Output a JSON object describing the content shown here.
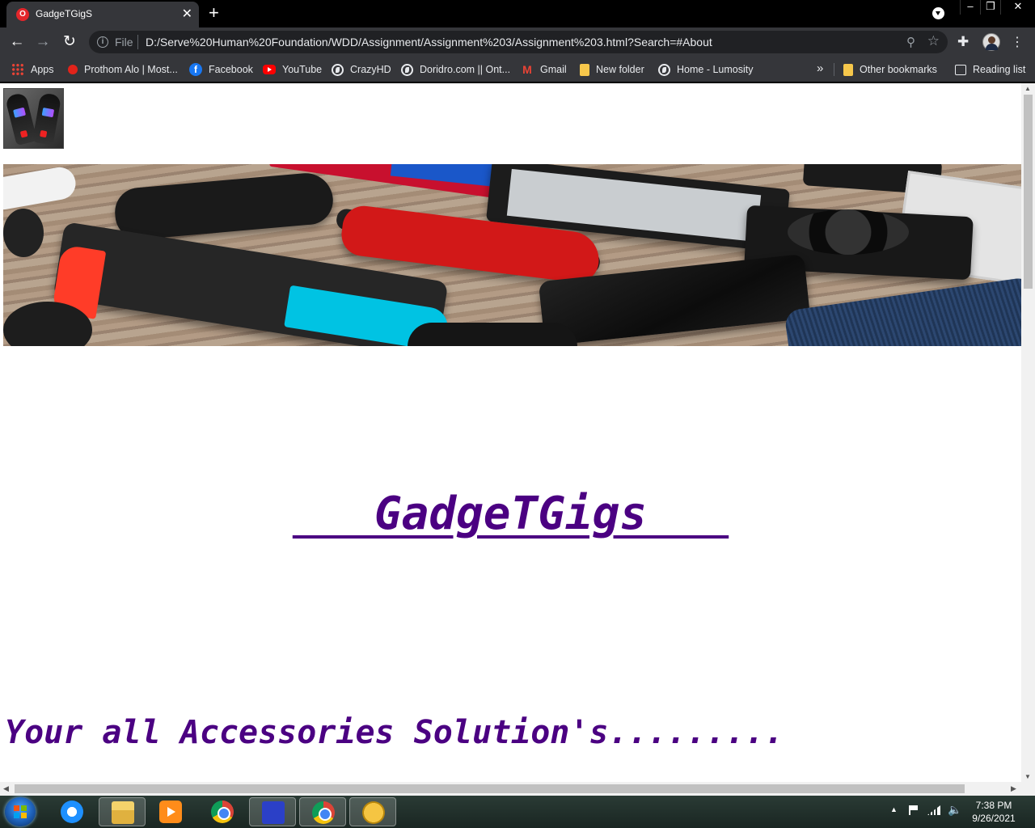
{
  "tab": {
    "title": "GadgeTGigS",
    "favicon": "opera-style-favicon"
  },
  "window": {
    "minimize_icon": "–",
    "restore_icon": "❐",
    "close_icon": "✕"
  },
  "toolbar": {
    "back_icon": "←",
    "forward_icon": "→",
    "reload_icon": "↻",
    "scheme_label": "File",
    "url": "D:/Serve%20Human%20Foundation/WDD/Assignment/Assignment%203/Assignment%203.html?Search=#About"
  },
  "bookmarks": [
    {
      "label": "Apps",
      "icon": "apps-grid-icon"
    },
    {
      "label": "Prothom Alo | Most...",
      "icon": "prothom-alo-icon"
    },
    {
      "label": "Facebook",
      "icon": "facebook-icon"
    },
    {
      "label": "YouTube",
      "icon": "youtube-icon"
    },
    {
      "label": "CrazyHD",
      "icon": "globe-icon"
    },
    {
      "label": "Doridro.com || Ont...",
      "icon": "globe-icon"
    },
    {
      "label": "Gmail",
      "icon": "gmail-icon"
    },
    {
      "label": "New folder",
      "icon": "folder-icon"
    },
    {
      "label": "Home - Lumosity",
      "icon": "globe-icon"
    }
  ],
  "bookmarks_overflow": "»",
  "other_bookmarks": "Other bookmarks",
  "reading_list": "Reading list",
  "page": {
    "site_title": "   GadgeTGigs   ",
    "tagline": "Your all Accessories Solution's........."
  },
  "taskbar": {
    "time": "7:38 PM",
    "date": "9/26/2021",
    "apps": [
      "internet-explorer-icon",
      "file-explorer-icon",
      "media-player-icon",
      "chrome-icon",
      "game-icon",
      "chrome-profile-icon",
      "web-globe-icon"
    ]
  }
}
